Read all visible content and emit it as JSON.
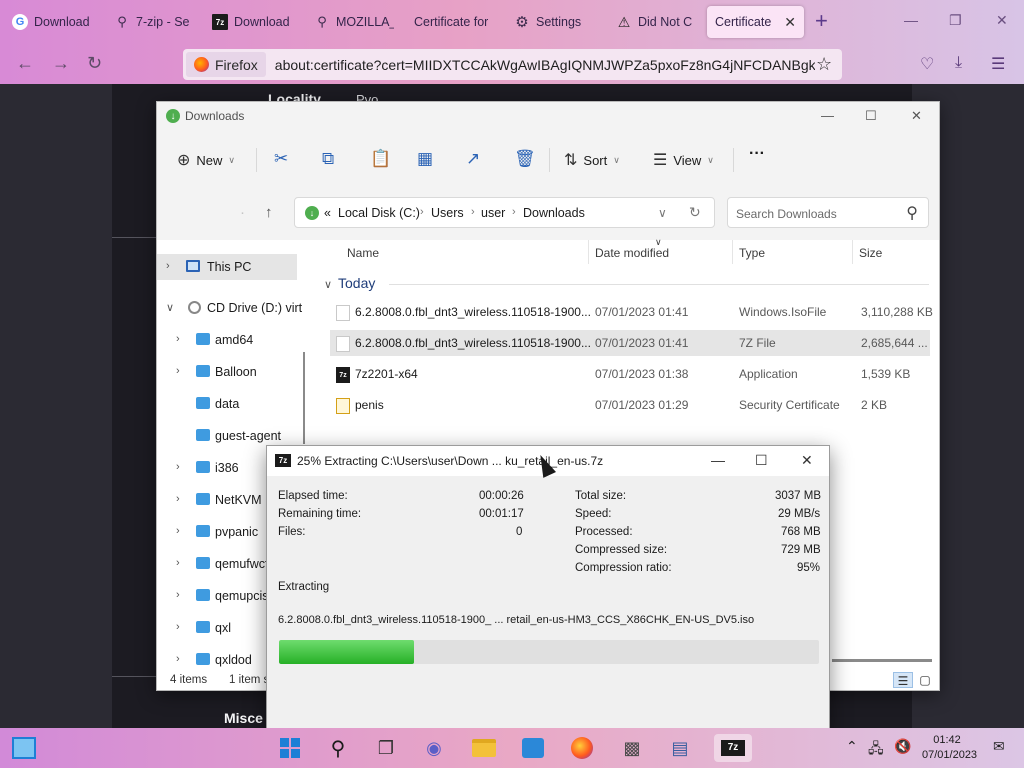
{
  "firefox": {
    "tabs": [
      {
        "label": "Download",
        "icon": "google-icon"
      },
      {
        "label": "7-zip - Sea",
        "icon": "search-icon"
      },
      {
        "label": "Download",
        "icon": "7zip-icon"
      },
      {
        "label": "MOZILLA_",
        "icon": "search-icon"
      },
      {
        "label": "Certificate for",
        "icon": ""
      },
      {
        "label": "Settings",
        "icon": "gear-icon"
      },
      {
        "label": "Did Not C",
        "icon": "warning-icon"
      },
      {
        "label": "Certificate f",
        "icon": "",
        "active": true
      }
    ],
    "identity_label": "Firefox",
    "url": "about:certificate?cert=MIIDXTCCAkWgAwIBAgIQNMJWPZa5pxoFz8nG4jNFCDANBgkqhk"
  },
  "page_behind": {
    "fragment_heading": "Locality",
    "fragment_value": "Pvo",
    "fragment_bottom": "Misce"
  },
  "explorer": {
    "title": "Downloads",
    "toolbar": {
      "new_label": "New",
      "sort_label": "Sort",
      "view_label": "View",
      "more_label": "···"
    },
    "breadcrumb": {
      "prefix": "«",
      "parts": [
        "Local Disk (C:)",
        "Users",
        "user",
        "Downloads"
      ]
    },
    "search_placeholder": "Search Downloads",
    "nav_items": [
      {
        "label": "This PC",
        "type": "pc",
        "selected": true
      },
      {
        "label": "CD Drive (D:) virt",
        "type": "cd",
        "expanded": true
      },
      {
        "label": "amd64",
        "type": "folder",
        "arrow": true
      },
      {
        "label": "Balloon",
        "type": "folder",
        "arrow": true
      },
      {
        "label": "data",
        "type": "folder",
        "arrow": false
      },
      {
        "label": "guest-agent",
        "type": "folder",
        "arrow": false
      },
      {
        "label": "i386",
        "type": "folder",
        "arrow": true
      },
      {
        "label": "NetKVM",
        "type": "folder",
        "arrow": true
      },
      {
        "label": "pvpanic",
        "type": "folder",
        "arrow": true
      },
      {
        "label": "qemufwcf",
        "type": "folder",
        "arrow": true
      },
      {
        "label": "qemupcise",
        "type": "folder",
        "arrow": true
      },
      {
        "label": "qxl",
        "type": "folder",
        "arrow": true
      },
      {
        "label": "qxldod",
        "type": "folder",
        "arrow": true
      }
    ],
    "columns": {
      "name": "Name",
      "date": "Date modified",
      "type": "Type",
      "size": "Size"
    },
    "group": "Today",
    "files": [
      {
        "name": "6.2.8008.0.fbl_dnt3_wireless.110518-1900...",
        "date": "07/01/2023 01:41",
        "type": "Windows.IsoFile",
        "size": "3,110,288 KB",
        "icon": "file-icon",
        "selected": false
      },
      {
        "name": "6.2.8008.0.fbl_dnt3_wireless.110518-1900...",
        "date": "07/01/2023 01:41",
        "type": "7Z File",
        "size": "2,685,644 ...",
        "icon": "file-icon",
        "selected": true
      },
      {
        "name": "7z2201-x64",
        "date": "07/01/2023 01:38",
        "type": "Application",
        "size": "1,539 KB",
        "icon": "7zip-icon",
        "selected": false
      },
      {
        "name": "penis",
        "date": "07/01/2023 01:29",
        "type": "Security Certificate",
        "size": "2 KB",
        "icon": "certificate-icon",
        "selected": false
      }
    ],
    "status_items": "4 items",
    "status_selected": "1 item s"
  },
  "zip": {
    "title": "25% Extracting C:\\Users\\user\\Down ... ku_retail_en-us.7z",
    "labels": {
      "elapsed": "Elapsed time:",
      "remaining": "Remaining time:",
      "files": "Files:",
      "total_size": "Total size:",
      "speed": "Speed:",
      "processed": "Processed:",
      "compressed_size": "Compressed size:",
      "compression_ratio": "Compression ratio:",
      "extracting": "Extracting"
    },
    "values": {
      "elapsed": "00:00:26",
      "remaining": "00:01:17",
      "files": "0",
      "total_size": "3037 MB",
      "speed": "29 MB/s",
      "processed": "768 MB",
      "compressed_size": "729 MB",
      "compression_ratio": "95%"
    },
    "current_file": "6.2.8008.0.fbl_dnt3_wireless.110518-1900_ ... retail_en-us-HM3_CCS_X86CHK_EN-US_DV5.iso",
    "progress_fraction": 0.25
  },
  "taskbar": {
    "icons": [
      "widgets-icon",
      "start-icon",
      "search-icon",
      "task-view-icon",
      "chat-icon",
      "file-explorer-icon",
      "store-icon",
      "firefox-icon",
      "network-drive-icon",
      "computer-icon",
      "7zip-icon"
    ],
    "time": "01:42",
    "date": "07/01/2023"
  }
}
